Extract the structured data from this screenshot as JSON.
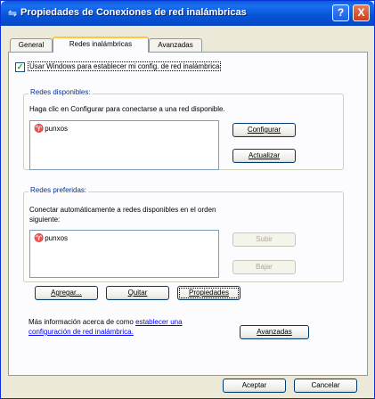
{
  "window": {
    "title": "Propiedades de Conexiones de red inalámbricas",
    "help_label": "?",
    "close_label": "X"
  },
  "tabs": [
    {
      "label": "General"
    },
    {
      "label": "Redes inalámbricas"
    },
    {
      "label": "Avanzadas"
    }
  ],
  "use_windows": {
    "label": "Usar Windows para establecer mi config. de red inalámbrica",
    "checked": true
  },
  "available": {
    "title": "Redes disponibles:",
    "description": "Haga clic en Configurar para conectarse a una red disponible.",
    "networks": [
      {
        "name": "punxos"
      }
    ],
    "configure_label": "Configurar",
    "refresh_label": "Actualizar"
  },
  "preferred": {
    "title": "Redes preferidas:",
    "description_line1": "Conectar automáticamente a redes disponibles en el orden",
    "description_line2": "siguiente:",
    "networks": [
      {
        "name": "punxos"
      }
    ],
    "up_label": "Subir",
    "down_label": "Bajar",
    "add_label": "Agregar...",
    "remove_label": "Quitar",
    "properties_label": "Propiedades"
  },
  "info": {
    "text_prefix": "Más información acerca de como",
    "link_part1": "establecer una",
    "link_part2": "configuración de red inalámbrica.",
    "advanced_label": "Avanzadas"
  },
  "footer": {
    "ok_label": "Aceptar",
    "cancel_label": "Cancelar"
  },
  "icons": {
    "title": "wireless-network-icon",
    "network": "wireless-antenna-icon"
  }
}
